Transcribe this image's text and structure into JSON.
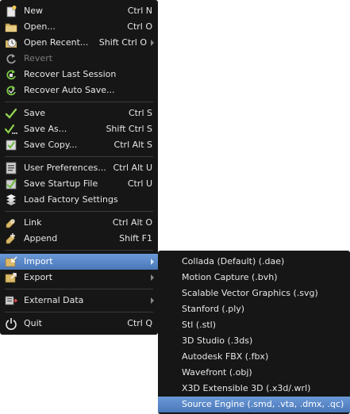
{
  "main_menu": {
    "new": {
      "label": "New",
      "shortcut": "Ctrl N",
      "icon": "new-file-icon"
    },
    "open": {
      "label": "Open...",
      "shortcut": "Ctrl O",
      "icon": "folder-icon"
    },
    "open_recent": {
      "label": "Open Recent...",
      "shortcut": "Shift Ctrl O",
      "icon": "recent-icon"
    },
    "revert": {
      "label": "Revert",
      "icon": "revert-icon"
    },
    "recover_last": {
      "label": "Recover Last Session",
      "icon": "recover-icon"
    },
    "recover_auto": {
      "label": "Recover Auto Save...",
      "icon": "recover-auto-icon"
    },
    "save": {
      "label": "Save",
      "shortcut": "Ctrl S",
      "icon": "checkmark-icon"
    },
    "save_as": {
      "label": "Save As...",
      "shortcut": "Shift Ctrl S",
      "icon": "checkmark-dots-icon"
    },
    "save_copy": {
      "label": "Save Copy...",
      "shortcut": "Ctrl Alt S",
      "icon": "save-copy-icon"
    },
    "user_prefs": {
      "label": "User Preferences...",
      "shortcut": "Ctrl Alt U",
      "icon": "preferences-icon"
    },
    "save_startup": {
      "label": "Save Startup File",
      "shortcut": "Ctrl U",
      "icon": "save-startup-icon"
    },
    "load_factory": {
      "label": "Load Factory Settings",
      "icon": "factory-settings-icon"
    },
    "link": {
      "label": "Link",
      "shortcut": "Ctrl Alt O",
      "icon": "link-icon"
    },
    "append": {
      "label": "Append",
      "shortcut": "Shift F1",
      "icon": "append-icon"
    },
    "import": {
      "label": "Import",
      "icon": "import-icon"
    },
    "export": {
      "label": "Export",
      "icon": "export-icon"
    },
    "external_data": {
      "label": "External Data",
      "icon": "external-data-icon"
    },
    "quit": {
      "label": "Quit",
      "shortcut": "Ctrl Q",
      "icon": "power-icon"
    }
  },
  "import_submenu": {
    "items": [
      "Collada (Default) (.dae)",
      "Motion Capture (.bvh)",
      "Scalable Vector Graphics (.svg)",
      "Stanford (.ply)",
      "Stl (.stl)",
      "3D Studio (.3ds)",
      "Autodesk FBX (.fbx)",
      "Wavefront (.obj)",
      "X3D Extensible 3D (.x3d/.wrl)",
      "Source Engine (.smd, .vta, .dmx, .qc)"
    ]
  },
  "colors": {
    "menu_background": "#0c0c0c",
    "highlight": "#5a88c8",
    "text": "#e6e6e6",
    "disabled_text": "#7a7a7a"
  }
}
